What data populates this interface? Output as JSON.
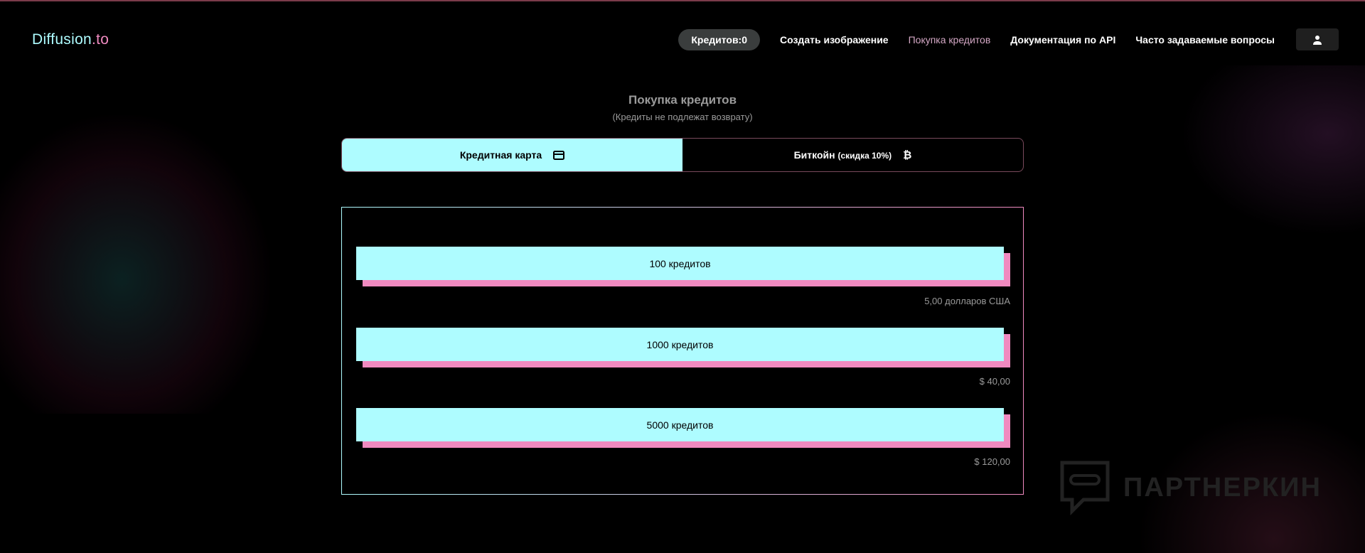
{
  "header": {
    "logo_part1": "Diffusion",
    "logo_part2": ".to",
    "credits_badge": "Кредитов:0",
    "nav": [
      "Создать изображение",
      "Покупка кредитов",
      "Документация по API",
      "Часто задаваемые вопросы"
    ]
  },
  "main": {
    "title": "Покупка кредитов",
    "subtitle": "(Кредиты не подлежат возврату)",
    "tabs": [
      {
        "label": "Кредитная карта",
        "icon": "credit-card-icon"
      },
      {
        "label": "Биткойн",
        "note": "(скидка 10%)",
        "icon": "bitcoin-icon"
      }
    ],
    "options": [
      {
        "label": "100 кредитов",
        "price": "5,00 долларов США"
      },
      {
        "label": "1000 кредитов",
        "price": "$ 40,00"
      },
      {
        "label": "5000 кредитов",
        "price": "$ 120,00"
      }
    ]
  },
  "watermark": "ПАРТНЕРКИН",
  "colors": {
    "accent": "#aefcff",
    "pink": "#f08ac0"
  }
}
